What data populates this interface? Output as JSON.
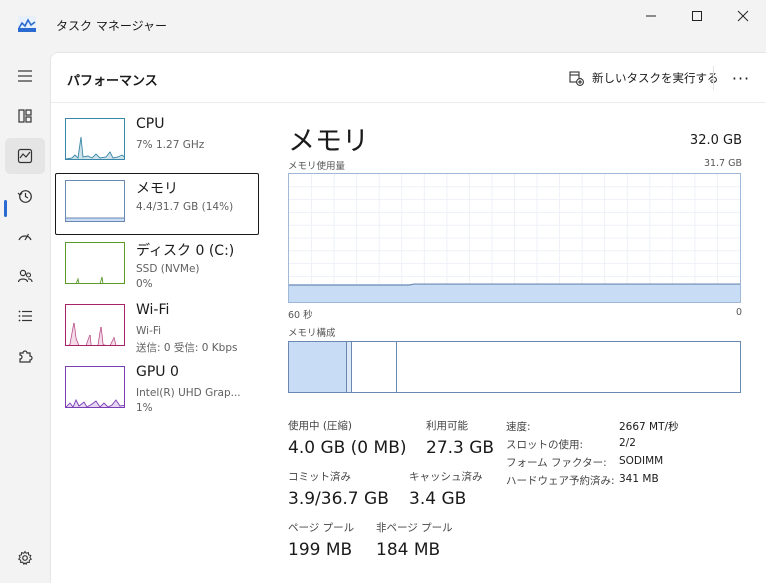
{
  "window": {
    "title": "タスク マネージャー"
  },
  "header": {
    "page_title": "パフォーマンス",
    "new_task_label": "新しいタスクを実行する",
    "more_label": "···"
  },
  "perf_list": [
    {
      "name": "CPU",
      "sub1": "7%  1.27 GHz",
      "sub2": ""
    },
    {
      "name": "メモリ",
      "sub1": "4.4/31.7 GB (14%)",
      "sub2": ""
    },
    {
      "name": "ディスク 0 (C:)",
      "sub1": "SSD (NVMe)",
      "sub2": "0%"
    },
    {
      "name": "Wi-Fi",
      "sub1": "Wi-Fi",
      "sub2": "送信: 0 受信: 0 Kbps"
    },
    {
      "name": "GPU 0",
      "sub1": "Intel(R) UHD Grap...",
      "sub2": "1%"
    }
  ],
  "memory": {
    "title": "メモリ",
    "total": "32.0 GB",
    "usage_label": "メモリ使用量",
    "usage_max": "31.7 GB",
    "time_left": "60 秒",
    "time_right": "0",
    "composition_label": "メモリ構成",
    "in_use_fraction": 0.14
  },
  "stats": {
    "in_use_label": "使用中 (圧縮)",
    "in_use_value": "4.0 GB (0 MB)",
    "available_label": "利用可能",
    "available_value": "27.3 GB",
    "committed_label": "コミット済み",
    "committed_value": "3.9/36.7 GB",
    "cached_label": "キャッシュ済み",
    "cached_value": "3.4 GB",
    "paged_label": "ページ プール",
    "paged_value": "199 MB",
    "nonpaged_label": "非ページ プール",
    "nonpaged_value": "184 MB"
  },
  "details": [
    {
      "label": "速度:",
      "value": "2667 MT/秒"
    },
    {
      "label": "スロットの使用:",
      "value": "2/2"
    },
    {
      "label": "フォーム ファクター:",
      "value": "SODIMM"
    },
    {
      "label": "ハードウェア予約済み:",
      "value": "341 MB"
    }
  ],
  "colors": {
    "accent": "#2b6bd1",
    "memory_fill": "#c9dcf5",
    "memory_line": "#6b88b0",
    "cpu": "#3a88a8",
    "disk": "#5c9a2c",
    "wifi": "#a8226a",
    "gpu": "#7a3fb3"
  }
}
